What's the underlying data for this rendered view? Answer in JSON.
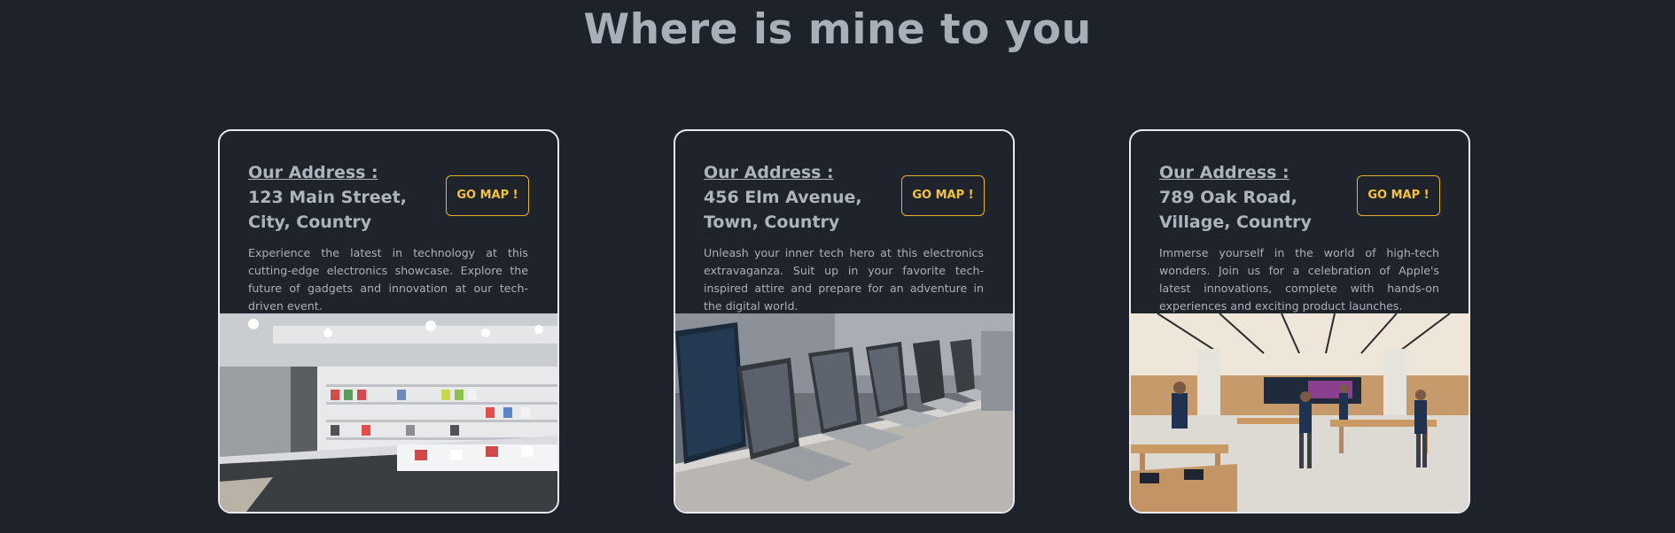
{
  "page": {
    "title": "Where is mine to you"
  },
  "cards": [
    {
      "address_label": "Our Address :",
      "address": "123 Main Street, City, Country",
      "button_label": "GO MAP !",
      "description": "Experience the latest in technology at this cutting-edge electronics showcase. Explore the future of gadgets and innovation at our tech-driven event.",
      "image_icon": "electronics-store-photo"
    },
    {
      "address_label": "Our Address :",
      "address": "456 Elm Avenue, Town, Country",
      "button_label": "GO MAP !",
      "description": "Unleash your inner tech hero at this electronics extravaganza. Suit up in your favorite tech-inspired attire and prepare for an adventure in the digital world.",
      "image_icon": "laptops-display-photo"
    },
    {
      "address_label": "Our Address :",
      "address": "789 Oak Road, Village, Country",
      "button_label": "GO MAP !",
      "description": "Immerse yourself in the world of high-tech wonders. Join us for a celebration of Apple's latest innovations, complete with hands-on experiences and exciting product launches.",
      "image_icon": "apple-store-photo"
    }
  ],
  "colors": {
    "background": "#1d222b",
    "card_border": "#e9ebee",
    "accent": "#f3c43a",
    "heading": "#a9afb9",
    "body_text": "#aab0ba"
  }
}
